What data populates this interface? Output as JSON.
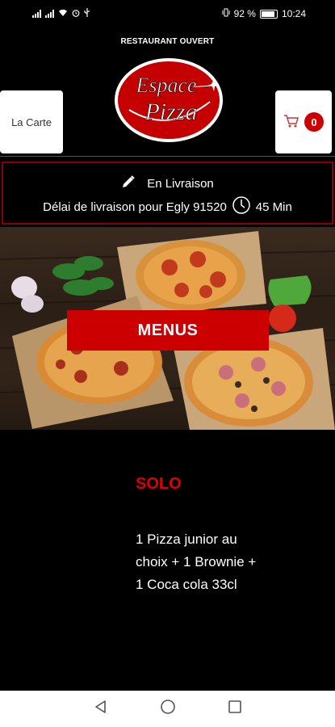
{
  "status_bar": {
    "battery": "92 %",
    "time": "10:24",
    "icons": [
      "signal-icon",
      "signal-icon",
      "wifi-icon",
      "alarm-icon",
      "usb-icon",
      "vibrate-icon",
      "battery-icon"
    ]
  },
  "header": {
    "open_label": "RESTAURANT OUVERT",
    "logo_line1": "Espace",
    "logo_line2": "Pizza",
    "menu_button": "La Carte",
    "cart_count": "0"
  },
  "delivery": {
    "mode": "En Livraison",
    "text": "Délai de livraison pour Egly 91520",
    "time": "45 Min"
  },
  "hero": {
    "button": "MENUS"
  },
  "offer": {
    "title": "SOLO",
    "description": "1 Pizza junior au choix + 1 Brownie + 1 Coca cola 33cl"
  },
  "colors": {
    "accent_red": "#cc0000",
    "background": "#000000",
    "border_red": "#8b0000"
  }
}
